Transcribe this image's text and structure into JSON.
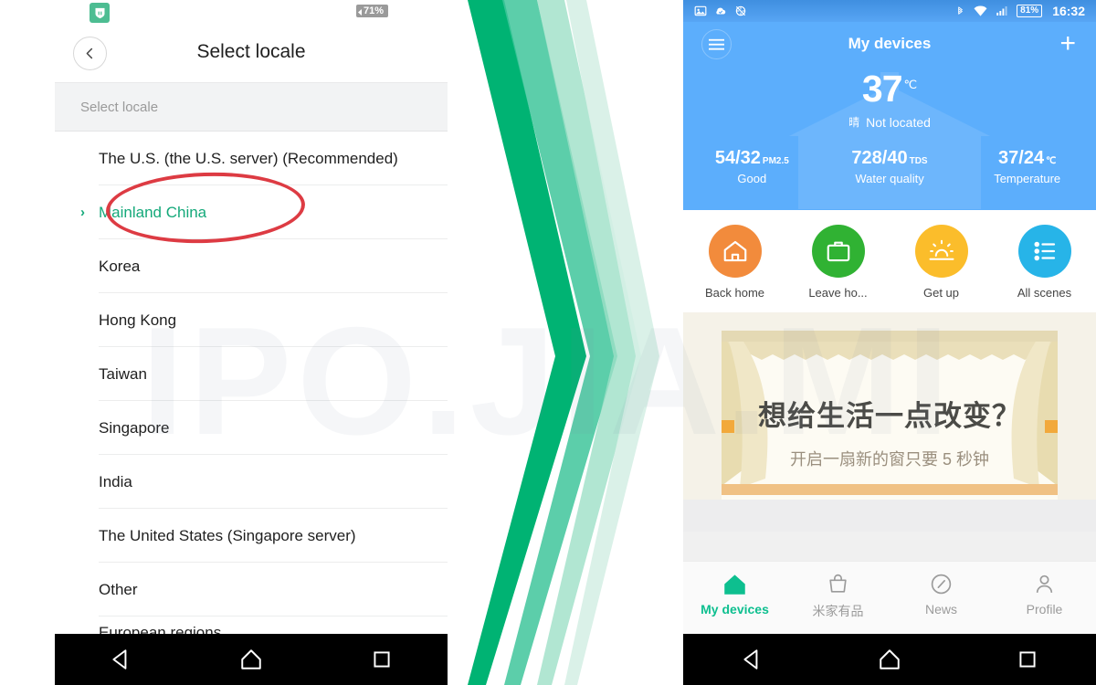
{
  "watermark": {
    "text": "IPO.JIA.MI"
  },
  "left_phone": {
    "status_bar": {
      "app_icon": "mihome-app-icon",
      "battery_label": "71%"
    },
    "header": {
      "back_icon": "back-chevron-icon",
      "title": "Select locale"
    },
    "section_header": "Select locale",
    "list_items": [
      {
        "label": "The U.S. (the U.S. server) (Recommended)",
        "selected": false
      },
      {
        "label": "Mainland China",
        "selected": true,
        "chevron": "›"
      },
      {
        "label": "Korea",
        "selected": false
      },
      {
        "label": "Hong Kong",
        "selected": false
      },
      {
        "label": "Taiwan",
        "selected": false
      },
      {
        "label": "Singapore",
        "selected": false
      },
      {
        "label": "India",
        "selected": false
      },
      {
        "label": "The United States (Singapore server)",
        "selected": false
      },
      {
        "label": "Other",
        "selected": false
      },
      {
        "label": "European regions",
        "selected": false
      }
    ],
    "annotation": {
      "shape": "red-ellipse",
      "color": "#dd3b43",
      "targets": "Mainland China"
    },
    "nav_bar": {
      "back": "back-triangle-icon",
      "home": "home-pentagon-icon",
      "recents": "recents-square-icon"
    }
  },
  "center_graphic": {
    "name": "green-chevron-artwork",
    "colors": [
      "#00b373",
      "#3fc69b",
      "#9ee0c7",
      "#d6f0e5"
    ]
  },
  "right_phone": {
    "status_bar": {
      "icons_left": [
        "screenshot-icon",
        "cloud-check-icon",
        "sync-disabled-icon"
      ],
      "icons_right": [
        "bluetooth-icon",
        "wifi-icon",
        "signal-icon"
      ],
      "battery_label": "81%",
      "clock": "16:32"
    },
    "app_header": {
      "menu_icon": "hamburger-menu-icon",
      "title": "My devices",
      "add_icon": "plus-icon"
    },
    "weather": {
      "temperature": "37",
      "unit": "℃",
      "condition_cn": "晴",
      "location": "Not located"
    },
    "metrics": [
      {
        "value": "54/32",
        "sub": "PM2.5",
        "caption": "Good"
      },
      {
        "value": "728/40",
        "sub": "TDS",
        "caption": "Water quality"
      },
      {
        "value": "37/24",
        "sub": "℃",
        "caption": "Temperature"
      }
    ],
    "scenes": [
      {
        "label": "Back home",
        "icon": "home-icon",
        "color": "#f28b3c"
      },
      {
        "label": "Leave ho...",
        "icon": "briefcase-icon",
        "color": "#30b233"
      },
      {
        "label": "Get up",
        "icon": "sunrise-icon",
        "color": "#fbbd2b"
      },
      {
        "label": "All scenes",
        "icon": "list-icon",
        "color": "#27b4e8"
      }
    ],
    "banner": {
      "title": "想给生活一点改变？",
      "subtitle": "开启一扇新的窗只要 5 秒钟"
    },
    "tabs": [
      {
        "label": "My devices",
        "icon": "house-icon",
        "active": true
      },
      {
        "label": "米家有品",
        "icon": "bag-icon",
        "active": false
      },
      {
        "label": "News",
        "icon": "compass-icon",
        "active": false
      },
      {
        "label": "Profile",
        "icon": "person-icon",
        "active": false
      }
    ],
    "nav_bar": {
      "back": "back-triangle-icon",
      "home": "home-pentagon-icon",
      "recents": "recents-square-icon"
    }
  }
}
